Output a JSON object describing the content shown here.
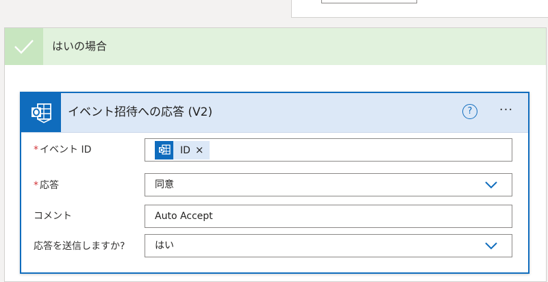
{
  "branch": {
    "title": "はいの場合",
    "icon": "checkmark-icon"
  },
  "action": {
    "title": "イベント招待への応答 (V2)",
    "connector_icon": "outlook-icon",
    "help_icon": "?",
    "more_icon": "···",
    "fields": {
      "event_id": {
        "required_mark": "*",
        "label": "イベント ID",
        "token_label": "ID",
        "token_remove": "×"
      },
      "response": {
        "required_mark": "*",
        "label": "応答",
        "value": "同意"
      },
      "comment": {
        "label": "コメント",
        "value": "Auto Accept"
      },
      "send_response": {
        "label": "応答を送信しますか?",
        "value": "はい"
      }
    }
  },
  "colors": {
    "accent": "#0f6cbd",
    "branch_header": "#e1f2dd",
    "required": "#d13438"
  }
}
